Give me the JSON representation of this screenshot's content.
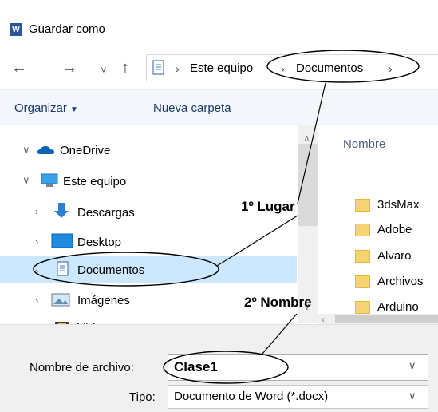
{
  "window": {
    "title": "Guardar como",
    "app_icon": "word-icon"
  },
  "nav": {
    "back": "←",
    "forward": "→",
    "recent": "˅",
    "up": "↑"
  },
  "address": {
    "path": [
      "Este equipo",
      "Documentos"
    ],
    "sep": "›"
  },
  "toolbar": {
    "organize": "Organizar",
    "new_folder": "Nueva carpeta"
  },
  "tree": {
    "onedrive": "OneDrive",
    "this_pc": "Este equipo",
    "downloads": "Descargas",
    "desktop": "Desktop",
    "documents": "Documentos",
    "images": "Imágenes",
    "videos": "Vídeos"
  },
  "content": {
    "column": "Nombre",
    "folders": [
      "3dsMax",
      "Adobe",
      "Alvaro",
      "Archivos",
      "Arduino"
    ]
  },
  "form": {
    "filename_label": "Nombre de archivo:",
    "filename_value": "Clase1",
    "type_label": "Tipo:",
    "type_value": "Documento de Word (*.docx)"
  },
  "annotations": {
    "first": "1º Lugar",
    "second": "2º Nombre"
  },
  "colors": {
    "selection": "#cce8ff",
    "accent": "#0078d7",
    "word": "#2b579a"
  }
}
